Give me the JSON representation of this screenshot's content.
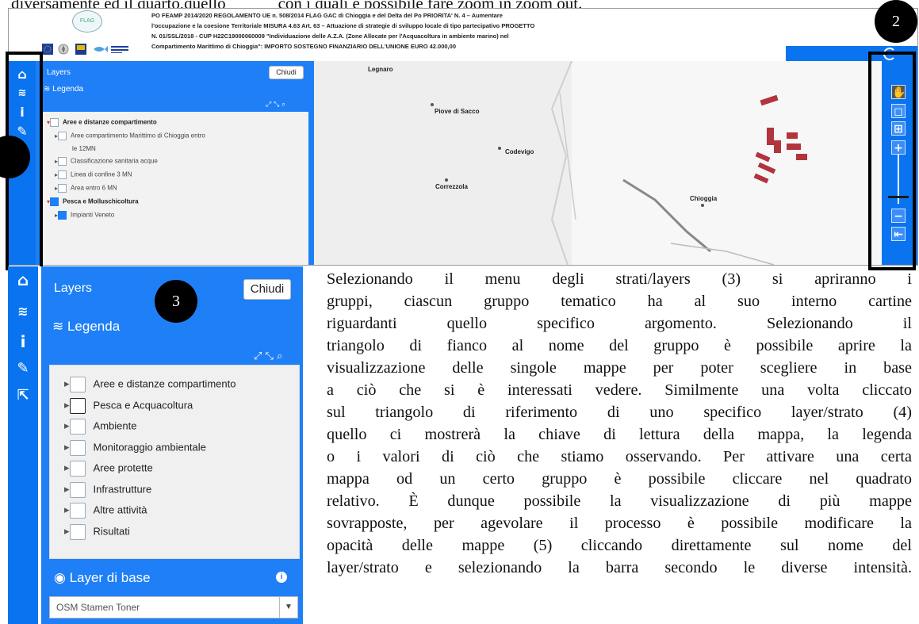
{
  "top_line": {
    "before": "diversamente ed il quarto,quello",
    "after": "con i quali è possibile fare zoom in zoom out."
  },
  "header": {
    "logo_text": "FLAG",
    "line1": "PO FEAMP 2014/2020 REGOLAMENTO UE n. 508/2014 FLAG GAC di Chioggia e del Delta del Po PRIORITA' N. 4 – Aumentare",
    "line2": "l'occupazione e la coesione Territoriale MISURA 4.63 Art. 63 – Attuazione di strategie di sviluppo locale di tipo partecipativo PROGETTO",
    "line3": "N. 01/SSL/2018 - CUP H22C19000060009 \"Individuazione delle A.Z.A. (Zone Allocate per l'Acquacoltura in ambiente marino) nel",
    "line4": "Compartimento Marittimo di Chioggia\": IMPORTO SOSTEGNO FINANZIARIO DELL'UNIONE EURO 42.000,00"
  },
  "panel_small": {
    "title": "Layers",
    "close": "Chiudi",
    "legend": "Legenda",
    "tree": [
      {
        "label": "Aree e distanze compartimento",
        "level": 0,
        "expanded": true,
        "bold": true
      },
      {
        "label": "Aree compartimento Marittimo di Chioggia entro",
        "level": 1
      },
      {
        "label": "le 12MN",
        "level": 1,
        "cont": true
      },
      {
        "label": "Classificazione sanitaria acque",
        "level": 1
      },
      {
        "label": "Linea di confine 3 MN",
        "level": 1
      },
      {
        "label": "Area entro 6 MN",
        "level": 1
      },
      {
        "label": "Pesca e Molluschicoltura",
        "level": 0,
        "expanded": true,
        "bold": true,
        "checked": true
      },
      {
        "label": "Impianti Veneto",
        "level": 1,
        "checked": true
      }
    ]
  },
  "map": {
    "towns": [
      "Legnaro",
      "Piove di Sacco",
      "Codevigo",
      "Correzzola",
      "Chioggia"
    ]
  },
  "panel_large": {
    "title": "Layers",
    "close": "Chiudi",
    "legend": "Legenda",
    "groups": [
      "Aree e distanze compartimento",
      "Pesca e Acquacoltura",
      "Ambiente",
      "Monitoraggio ambientale",
      "Aree protette",
      "Infrastrutture",
      "Altre attività",
      "Risultati"
    ],
    "base_title": "Layer di base",
    "base_value": "OSM Stamen Toner"
  },
  "badges": {
    "b2": "2",
    "b3": "3"
  },
  "paragraph": [
    "Selezionando il menu degli strati/layers (3) si apriranno i",
    "gruppi, ciascun gruppo tematico ha al suo interno cartine",
    "riguardanti quello specifico argomento. Selezionando il",
    "triangolo di fianco al nome del gruppo è possibile aprire la",
    "visualizzazione delle singole mappe per poter scegliere in base",
    "a ciò che si è interessati vedere. Similmente una volta cliccato",
    "sul triangolo di riferimento di uno specifico layer/strato (4)",
    "quello ci mostrerà la chiave di lettura della mappa, la legenda",
    "o i valori di ciò che stiamo osservando. Per attivare una certa",
    "mappa od un certo gruppo è possibile cliccare nel quadrato",
    "relativo. È dunque possibile la visualizzazione di più mappe",
    "sovrapposte, per agevolare il processo è possibile modificare la",
    "opacità delle mappe (5) cliccando direttamente sul nome del",
    "layer/strato e selezionando la barra secondo le diverse intensità."
  ]
}
